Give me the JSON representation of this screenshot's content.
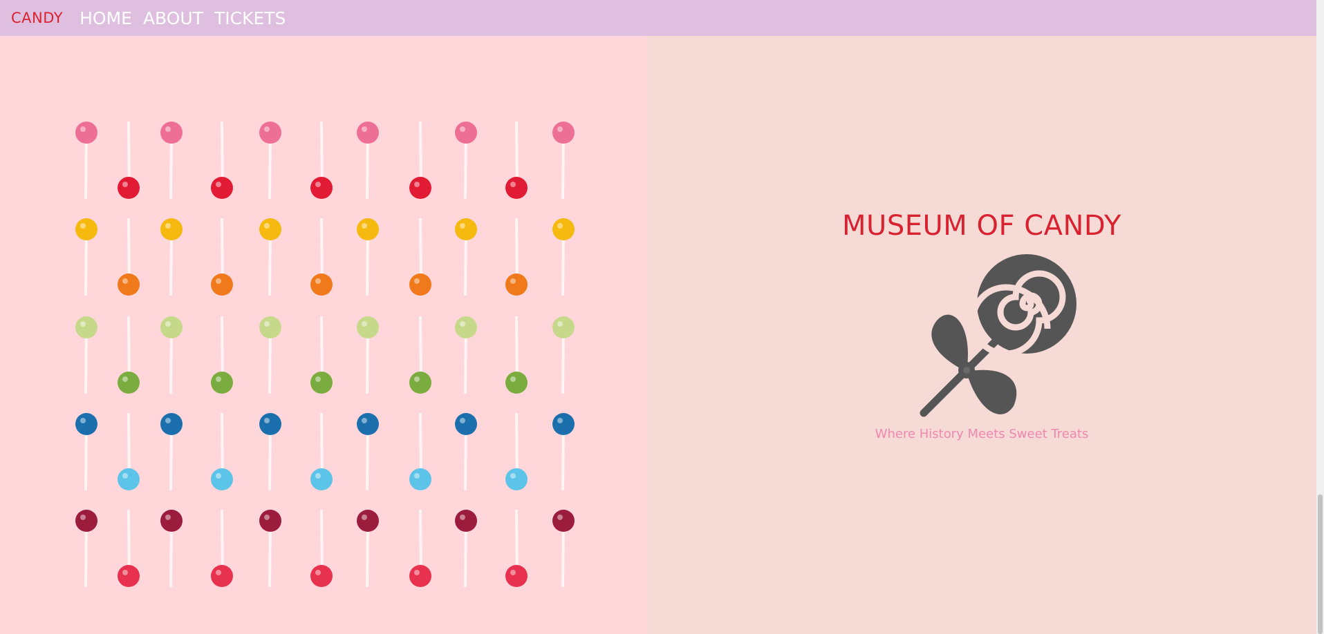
{
  "navbar": {
    "brand": "CANDY",
    "links": [
      "HOME",
      "ABOUT",
      "TICKETS"
    ]
  },
  "hero": {
    "title": "MUSEUM OF CANDY",
    "tagline": "Where History Meets Sweet Treats",
    "logo_icon": "lollipop-candy-icon"
  },
  "image": {
    "description_icon": "lollipop-pattern-image",
    "lollipop_colors": [
      "#ee6f95",
      "#e21b35",
      "#f6b90f",
      "#f07a1b",
      "#c6d88a",
      "#7aac3f",
      "#1b6fad",
      "#5cc4e8",
      "#9c1c3d",
      "#e8304f"
    ]
  },
  "colors": {
    "navbar_bg": "#dfbfdf",
    "accent_red": "#d9222f",
    "tagline_pink": "#ee88b0",
    "icon_gray": "#555555"
  }
}
